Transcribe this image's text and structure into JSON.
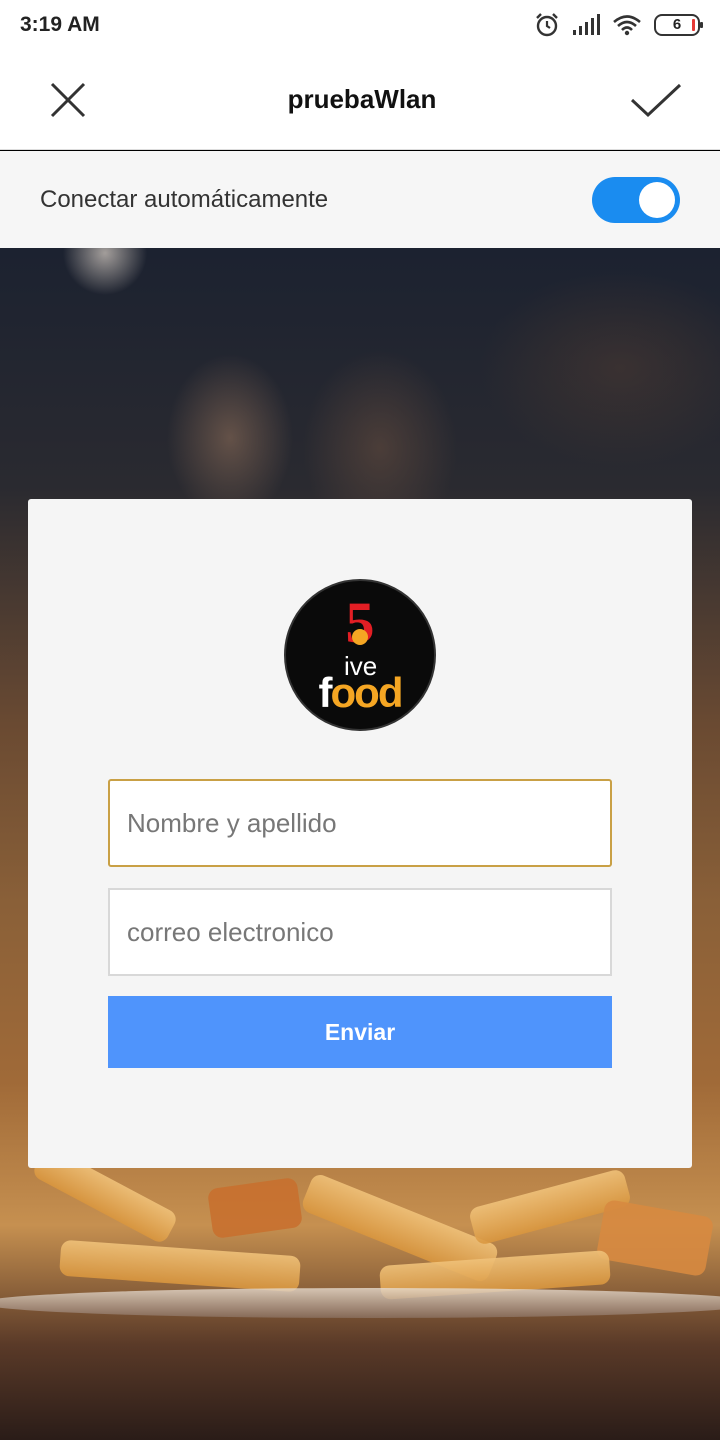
{
  "status_bar": {
    "time": "3:19 AM",
    "battery_level": "6",
    "icons": [
      "alarm-icon",
      "signal-icon",
      "wifi-icon",
      "battery-icon"
    ]
  },
  "header": {
    "title": "pruebaWlan",
    "close_icon": "close-icon",
    "confirm_icon": "check-icon"
  },
  "auto_connect": {
    "label": "Conectar automáticamente",
    "enabled": true,
    "accent_color": "#1a8cf0"
  },
  "portal": {
    "logo": {
      "digit": "5",
      "word_top": "ive",
      "word_bottom_first": "f",
      "word_bottom_rest": "ood"
    },
    "name_field": {
      "placeholder": "Nombre y apellido",
      "value": ""
    },
    "email_field": {
      "placeholder": "correo electronico",
      "value": ""
    },
    "submit_label": "Enviar",
    "button_color": "#4f94fc"
  }
}
